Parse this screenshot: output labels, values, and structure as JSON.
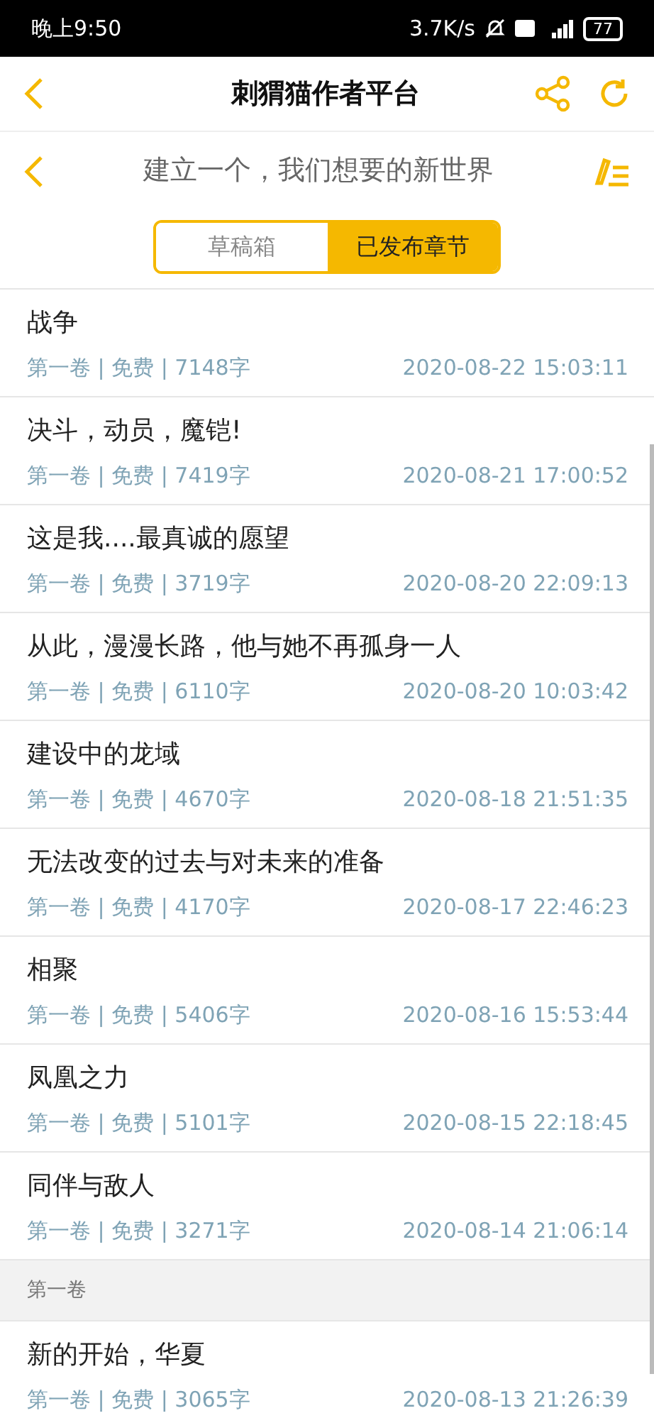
{
  "status_bar": {
    "time": "晚上9:50",
    "speed": "3.7K/s",
    "battery": "77"
  },
  "header": {
    "title": "刺猬猫作者平台"
  },
  "book": {
    "title": "建立一个，我们想要的新世界"
  },
  "tabs": [
    {
      "label": "草稿箱",
      "selected": false
    },
    {
      "label": "已发布章节",
      "selected": true
    }
  ],
  "items": [
    {
      "kind": "chapter",
      "title": "战争",
      "meta": "第一卷 | 免费 | 7148字",
      "time": "2020-08-22 15:03:11"
    },
    {
      "kind": "chapter",
      "title": "决斗，动员，魔铠!",
      "meta": "第一卷 | 免费 | 7419字",
      "time": "2020-08-21 17:00:52"
    },
    {
      "kind": "chapter",
      "title": "这是我....最真诚的愿望",
      "meta": "第一卷 | 免费 | 3719字",
      "time": "2020-08-20 22:09:13"
    },
    {
      "kind": "chapter",
      "title": "从此，漫漫长路，他与她不再孤身一人",
      "meta": "第一卷 | 免费 | 6110字",
      "time": "2020-08-20 10:03:42"
    },
    {
      "kind": "chapter",
      "title": "建设中的龙域",
      "meta": "第一卷 | 免费 | 4670字",
      "time": "2020-08-18 21:51:35"
    },
    {
      "kind": "chapter",
      "title": "无法改变的过去与对未来的准备",
      "meta": "第一卷 | 免费 | 4170字",
      "time": "2020-08-17 22:46:23"
    },
    {
      "kind": "chapter",
      "title": "相聚",
      "meta": "第一卷 | 免费 | 5406字",
      "time": "2020-08-16 15:53:44"
    },
    {
      "kind": "chapter",
      "title": "凤凰之力",
      "meta": "第一卷 | 免费 | 5101字",
      "time": "2020-08-15 22:18:45"
    },
    {
      "kind": "chapter",
      "title": "同伴与敌人",
      "meta": "第一卷 | 免费 | 3271字",
      "time": "2020-08-14 21:06:14"
    },
    {
      "kind": "section",
      "title": "第一卷"
    },
    {
      "kind": "chapter",
      "title": "新的开始，华夏",
      "meta": "第一卷 | 免费 | 3065字",
      "time": "2020-08-13 21:26:39"
    }
  ]
}
